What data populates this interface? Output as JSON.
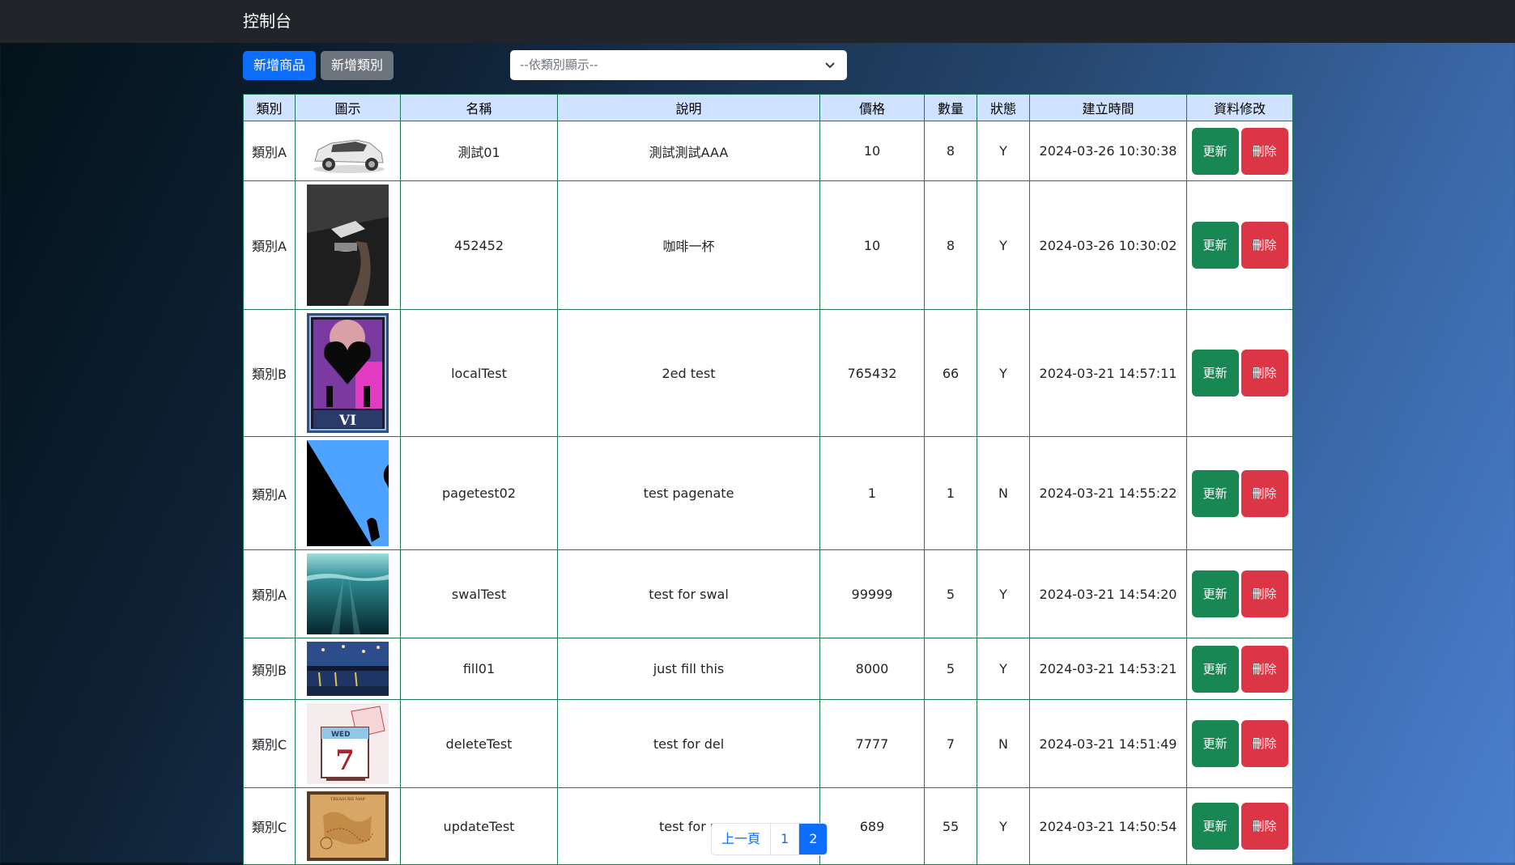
{
  "header": {
    "title": "控制台"
  },
  "toolbar": {
    "add_product_label": "新增商品",
    "add_category_label": "新增類別",
    "category_filter_selected": "--依類別顯示--"
  },
  "table": {
    "columns": [
      "類別",
      "圖示",
      "名稱",
      "說明",
      "價格",
      "數量",
      "狀態",
      "建立時間",
      "資料修改"
    ],
    "rows": [
      {
        "category": "類別A",
        "image": "car-photo",
        "name": "測試01",
        "description": "測試測試AAA",
        "price": "10",
        "quantity": "8",
        "status": "Y",
        "created": "2024-03-26 10:30:38"
      },
      {
        "category": "類別A",
        "image": "coffee-photo",
        "name": "452452",
        "description": "咖啡一杯",
        "price": "10",
        "quantity": "8",
        "status": "Y",
        "created": "2024-03-26 10:30:02"
      },
      {
        "category": "類別B",
        "image": "tarot-card-vi",
        "name": "localTest",
        "description": "2ed test",
        "price": "765432",
        "quantity": "66",
        "status": "Y",
        "created": "2024-03-21 14:57:11"
      },
      {
        "category": "類別A",
        "image": "silhouette-cliff",
        "name": "pagetest02",
        "description": "test pagenate",
        "price": "1",
        "quantity": "1",
        "status": "N",
        "created": "2024-03-21 14:55:22"
      },
      {
        "category": "類別A",
        "image": "underwater-scene",
        "name": "swalTest",
        "description": "test for swal",
        "price": "99999",
        "quantity": "5",
        "status": "Y",
        "created": "2024-03-21 14:54:20"
      },
      {
        "category": "類別B",
        "image": "starry-night-painting",
        "name": "fill01",
        "description": "just fill this",
        "price": "8000",
        "quantity": "5",
        "status": "Y",
        "created": "2024-03-21 14:53:21"
      },
      {
        "category": "類別C",
        "image": "calendar-wed-7",
        "name": "deleteTest",
        "description": "test for del",
        "price": "7777",
        "quantity": "7",
        "status": "N",
        "created": "2024-03-21 14:51:49"
      },
      {
        "category": "類別C",
        "image": "treasure-map",
        "name": "updateTest",
        "description": "test for u",
        "price": "689",
        "quantity": "55",
        "status": "Y",
        "created": "2024-03-21 14:50:54"
      }
    ],
    "update_label": "更新",
    "delete_label": "刪除",
    "image_text": {
      "tarot_numeral": "VI",
      "calendar_day": "WED",
      "calendar_date": "7",
      "map_title": "TREASURE MAP"
    }
  },
  "pagination": {
    "prev_label": "上一頁",
    "pages": [
      "1",
      "2"
    ],
    "current": "2"
  },
  "colors": {
    "navbar": "#212529",
    "primary": "#0d6efd",
    "secondary": "#6c757d",
    "header_bg": "#cfe2ff",
    "border": "#1e7a52",
    "update": "#198754",
    "delete": "#dc3545"
  }
}
